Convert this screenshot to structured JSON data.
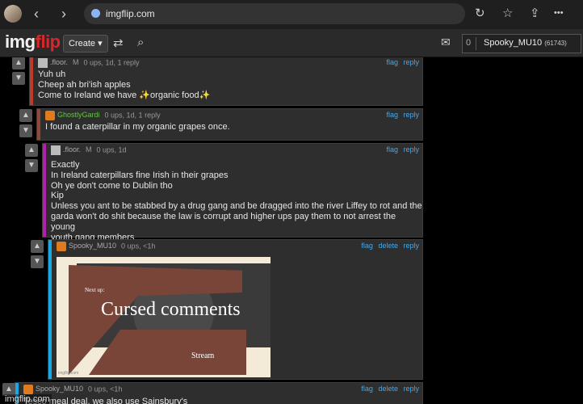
{
  "browser": {
    "url": "imgflip.com"
  },
  "header": {
    "logo_main": "img",
    "logo_accent": "flip",
    "create_label": "Create ▾",
    "notif_count": "0",
    "username": "Spooky_MU10",
    "points": "(61743)"
  },
  "icons": {
    "back": "‹",
    "forward": "›",
    "reload": "↻",
    "favorite": "☆",
    "share": "⇪",
    "more": "•••",
    "shuffle": "⇄",
    "search": "⌕",
    "mail": "✉",
    "upvote": "▲",
    "downvote": "▼"
  },
  "colors": {
    "bar_red": "#c0392b",
    "bar_brown": "#8b4a3a",
    "bar_magenta": "#b21fa8",
    "bar_blue": "#19a9e0",
    "link": "#47a7e7"
  },
  "comments": [
    {
      "user": ".floor.",
      "badge": "M",
      "meta": "0 ups, 1d, 1 reply",
      "actions": [
        "flag",
        "reply"
      ],
      "lines": [
        "Yuh uh",
        "Cheep ah bri'ish apples",
        "Come to Ireland we have ✨organic food✨"
      ]
    },
    {
      "user": "GhostlyGardi",
      "badge": "",
      "meta": "0 ups, 1d, 1 reply",
      "actions": [
        "flag",
        "reply"
      ],
      "lines": [
        "I found a caterpillar in my organic grapes once."
      ]
    },
    {
      "user": ".floor.",
      "badge": "M",
      "meta": "0 ups, 1d",
      "actions": [
        "flag",
        "reply"
      ],
      "lines": [
        "Exactly",
        "In Ireland caterpillars fine Irish in their grapes",
        "Oh ye don't come to Dublin tho",
        "Kip",
        "Unless you ant to be stabbed by a drug gang and be dragged into the river Liffey to rot and the",
        "garda won't do shit because the law is corrupt and higher ups pay them to not arrest the young",
        "youth gang members"
      ]
    },
    {
      "user": "Spooky_MU10",
      "badge": "",
      "meta": "0 ups, <1h",
      "actions": [
        "flag",
        "delete",
        "reply"
      ],
      "meme": {
        "small": "Next up:",
        "title": "Cursed comments",
        "sub": "Stream",
        "wm": "imgflip.com"
      }
    },
    {
      "user": "Spooky_MU10",
      "badge": "",
      "meta": "0 ups, <1h",
      "actions": [
        "flag",
        "delete",
        "reply"
      ],
      "lines": [
        "Tesco meal deal, we also use Sainsbury's"
      ]
    }
  ],
  "watermark": "imgflip.com"
}
